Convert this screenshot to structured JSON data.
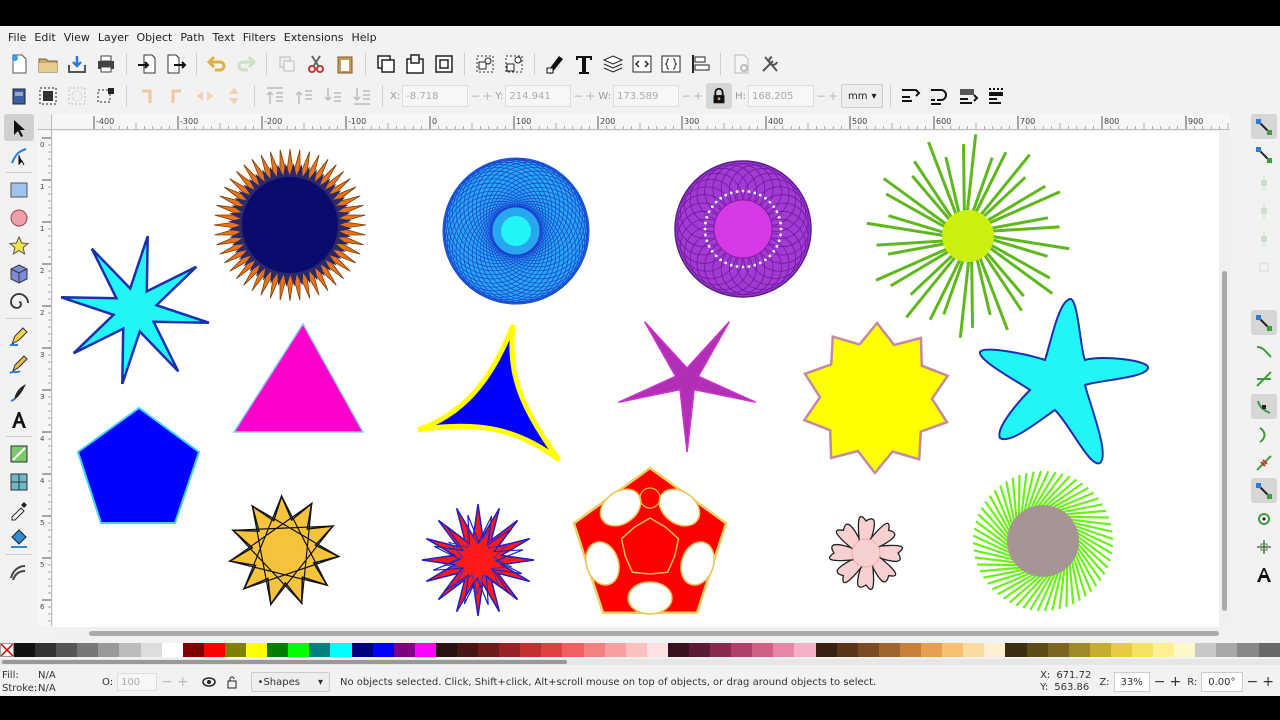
{
  "menu": [
    "File",
    "Edit",
    "View",
    "Layer",
    "Object",
    "Path",
    "Text",
    "Filters",
    "Extensions",
    "Help"
  ],
  "toolbar": {
    "x_label": "X:",
    "x_value": "-8.718",
    "y_label": "Y:",
    "y_value": "214.941",
    "w_label": "W:",
    "w_value": "173.589",
    "h_label": "H:",
    "h_value": "168.205",
    "units": "mm"
  },
  "ruler": {
    "h_ticks": [
      "-400",
      "-300",
      "-200",
      "-100",
      "0",
      "100",
      "200",
      "300",
      "400",
      "500",
      "600",
      "700",
      "800",
      "900"
    ],
    "v_ticks": [
      "0",
      "1",
      "1",
      "2",
      "2",
      "3",
      "3",
      "4",
      "4",
      "5",
      "5",
      "6"
    ]
  },
  "status": {
    "fill_label": "Fill:",
    "fill_value": "N/A",
    "stroke_label": "Stroke:",
    "stroke_value": "N/A",
    "opacity_label": "O:",
    "opacity_value": "100",
    "layer": "•Shapes",
    "message": "No objects selected. Click, Shift+click, Alt+scroll mouse on top of objects, or drag around objects to select.",
    "cx_label": "X:",
    "cx_value": "671.72",
    "cy_label": "Y:",
    "cy_value": "563.86",
    "zoom_label": "Z:",
    "zoom_value": "33%",
    "rot_label": "R:",
    "rot_value": "0.00°"
  },
  "colors": {
    "accent": "#3b6fd9",
    "canvas_bg": "#ffffff",
    "shape_cyan": "#22f5f7",
    "shape_blue": "#0000ff",
    "shape_magenta": "#ff00cc",
    "shape_yellow": "#ffff00",
    "shape_purple": "#a33ad6",
    "shape_green": "#7fd81b",
    "shape_red": "#ff0000"
  },
  "palette": [
    "#111111",
    "#333333",
    "#555555",
    "#777777",
    "#999999",
    "#bbbbbb",
    "#dddddd",
    "#ffffff",
    "#800000",
    "#ff0000",
    "#808000",
    "#ffff00",
    "#008000",
    "#00ff00",
    "#008080",
    "#00ffff",
    "#000080",
    "#0000ff",
    "#800080",
    "#ff00ff",
    "#2b1010",
    "#4a1515",
    "#701c1c",
    "#9a2424",
    "#c23030",
    "#e04040",
    "#f06060",
    "#f58080",
    "#f8a0a0",
    "#fbc0c0",
    "#fde0e0",
    "#3a1020",
    "#5c1a34",
    "#8a2a4e",
    "#b0406a",
    "#d06088",
    "#e888a8",
    "#f4b0c8",
    "#3a2010",
    "#5c3418",
    "#7a4a22",
    "#a0642c",
    "#c88038",
    "#e8a050",
    "#f8c070",
    "#fcdc9c",
    "#fef0d0",
    "#3a3010",
    "#5c4c18",
    "#7a6620",
    "#a08a28",
    "#c8ac30",
    "#e8cc40",
    "#f8e060",
    "#fcf090",
    "#fef8c8",
    "#c8c8c8",
    "#a8a8a8",
    "#888888",
    "#686868"
  ],
  "tools": [
    "selector-icon",
    "node-icon",
    "rect-icon",
    "circle-icon",
    "star-icon",
    "box3d-icon",
    "spiral-icon",
    "pen-icon",
    "pencil-icon",
    "calligraphy-icon",
    "text-icon",
    "gradient-icon",
    "mesh-icon",
    "dropper-icon",
    "paintbucket-icon",
    "tweak-icon"
  ]
}
